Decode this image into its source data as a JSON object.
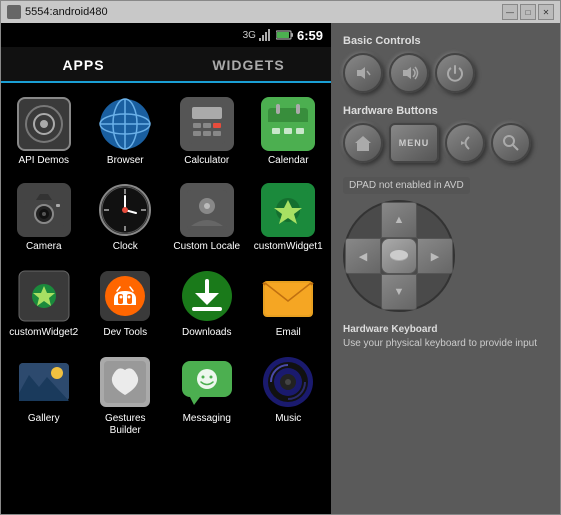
{
  "window": {
    "title": "5554:android480",
    "controls": {
      "minimize": "—",
      "maximize": "□",
      "close": "✕"
    }
  },
  "statusBar": {
    "signal": "3G",
    "time": "6:59"
  },
  "tabs": [
    {
      "id": "apps",
      "label": "APPS",
      "active": true
    },
    {
      "id": "widgets",
      "label": "WIDGETS",
      "active": false
    }
  ],
  "apps": [
    {
      "id": "api-demos",
      "label": "API Demos",
      "icon": "api"
    },
    {
      "id": "browser",
      "label": "Browser",
      "icon": "browser"
    },
    {
      "id": "calculator",
      "label": "Calculator",
      "icon": "calculator"
    },
    {
      "id": "calendar",
      "label": "Calendar",
      "icon": "calendar"
    },
    {
      "id": "camera",
      "label": "Camera",
      "icon": "camera"
    },
    {
      "id": "clock",
      "label": "Clock",
      "icon": "clock"
    },
    {
      "id": "custom-locale",
      "label": "Custom Locale",
      "icon": "custom-locale"
    },
    {
      "id": "custom-widget1",
      "label": "customWidget1",
      "icon": "custom-widget1"
    },
    {
      "id": "custom-widget2",
      "label": "customWidget2",
      "icon": "custom-widget2"
    },
    {
      "id": "dev-tools",
      "label": "Dev Tools",
      "icon": "dev-tools"
    },
    {
      "id": "downloads",
      "label": "Downloads",
      "icon": "downloads"
    },
    {
      "id": "email",
      "label": "Email",
      "icon": "email"
    },
    {
      "id": "gallery",
      "label": "Gallery",
      "icon": "gallery"
    },
    {
      "id": "gestures-builder",
      "label": "Gestures Builder",
      "icon": "gestures"
    },
    {
      "id": "messaging",
      "label": "Messaging",
      "icon": "messaging"
    },
    {
      "id": "music",
      "label": "Music",
      "icon": "music"
    }
  ],
  "rightPanel": {
    "sections": {
      "basicControls": {
        "title": "Basic Controls",
        "buttons": [
          "volume-down",
          "volume-up",
          "power"
        ]
      },
      "hardwareButtons": {
        "title": "Hardware Buttons",
        "buttons": [
          "home",
          "menu",
          "back",
          "search"
        ]
      },
      "dpad": {
        "disabledText": "DPAD not enabled in AVD"
      },
      "keyboard": {
        "title": "Hardware Keyboard",
        "description": "Use your physical keyboard to provide input"
      }
    }
  }
}
